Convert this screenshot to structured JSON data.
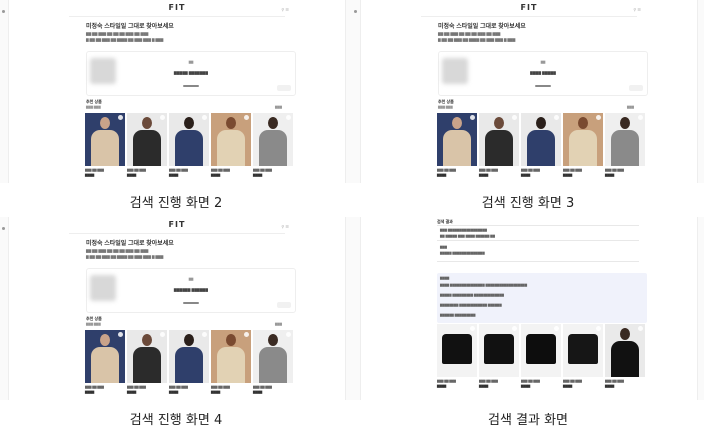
{
  "screens": [
    {
      "label": "검색 진행 화면 2",
      "logo": "FIT",
      "title": "미정숙 스타일일 그대로 찾아보세요",
      "loading_message": "..."
    },
    {
      "label": "검색 진행 화면 3",
      "logo": "FIT",
      "title": "미정숙 스타일일 그대로 찾아보세요",
      "loading_message": "..."
    },
    {
      "label": "검색 진행 화면 4",
      "logo": "FIT",
      "title": "미정숙 스타일일 그대로 찾아보세요",
      "loading_message": "..."
    },
    {
      "label": "검색 결과 화면",
      "title": "검색 결과"
    }
  ],
  "section": {
    "title": "추천 상품"
  },
  "colors": {
    "navy": "#2f3f6b",
    "beige": "#d9c4a8",
    "gray_bg": "#e9e9e9",
    "result_box": "#f0f2fb"
  }
}
